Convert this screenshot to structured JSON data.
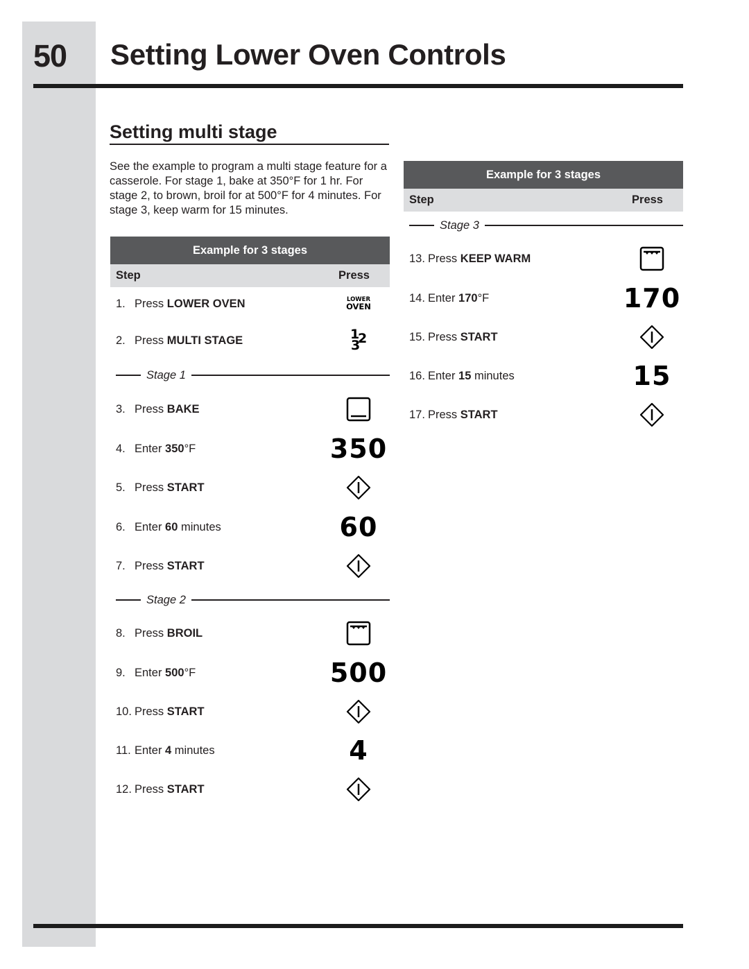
{
  "page": {
    "number": "50",
    "title": "Setting Lower Oven Controls"
  },
  "section": {
    "title": "Setting multi stage",
    "intro": "See the example to program a multi stage feature for a casserole. For stage 1, bake at 350°F for 1 hr. For stage 2, to brown, broil for at 500°F for 4 minutes. For stage 3, keep warm for 15 minutes."
  },
  "tables": [
    {
      "title": "Example for 3 stages",
      "col_step": "Step",
      "col_press": "Press"
    },
    {
      "title": "Example for 3 stages",
      "col_step": "Step",
      "col_press": "Press"
    }
  ],
  "stages": [
    "Stage 1",
    "Stage 2",
    "Stage 3"
  ],
  "steps": [
    {
      "num": "1.",
      "verb": "Press",
      "bold": "LOWER OVEN",
      "suffix": "",
      "icon": "lower-oven-key",
      "icon_text_small": "LOWER",
      "icon_text_large": "OVEN"
    },
    {
      "num": "2.",
      "verb": "Press",
      "bold": "MULTI STAGE",
      "suffix": "",
      "icon": "multi-stage-key",
      "icon_digits": [
        "1",
        "2",
        "3"
      ]
    },
    {
      "num": "3.",
      "verb": "Press",
      "bold": "BAKE",
      "suffix": "",
      "icon": "bake-icon"
    },
    {
      "num": "4.",
      "verb": "Enter",
      "bold": "350",
      "suffix": "°F",
      "display": "350"
    },
    {
      "num": "5.",
      "verb": "Press",
      "bold": "START",
      "suffix": "",
      "icon": "start-icon"
    },
    {
      "num": "6.",
      "verb": "Enter",
      "bold": "60",
      "suffix": " minutes",
      "display": "60"
    },
    {
      "num": "7.",
      "verb": "Press",
      "bold": "START",
      "suffix": "",
      "icon": "start-icon"
    },
    {
      "num": "8.",
      "verb": "Press",
      "bold": "BROIL",
      "suffix": "",
      "icon": "broil-icon"
    },
    {
      "num": "9.",
      "verb": "Enter",
      "bold": "500",
      "suffix": "°F",
      "display": "500"
    },
    {
      "num": "10.",
      "verb": "Press",
      "bold": "START",
      "suffix": "",
      "icon": "start-icon"
    },
    {
      "num": "11.",
      "verb": "Enter",
      "bold": "4",
      "suffix": " minutes",
      "display": "4"
    },
    {
      "num": "12.",
      "verb": "Press",
      "bold": "START",
      "suffix": "",
      "icon": "start-icon"
    },
    {
      "num": "13.",
      "verb": "Press",
      "bold": "KEEP WARM",
      "suffix": "",
      "icon": "keep-warm-icon"
    },
    {
      "num": "14.",
      "verb": "Enter",
      "bold": "170",
      "suffix": "°F",
      "display": "170"
    },
    {
      "num": "15.",
      "verb": "Press",
      "bold": "START",
      "suffix": "",
      "icon": "start-icon"
    },
    {
      "num": "16.",
      "verb": "Enter",
      "bold": "15",
      "suffix": " minutes",
      "display": "15"
    },
    {
      "num": "17.",
      "verb": "Press",
      "bold": "START",
      "suffix": "",
      "icon": "start-icon"
    }
  ]
}
